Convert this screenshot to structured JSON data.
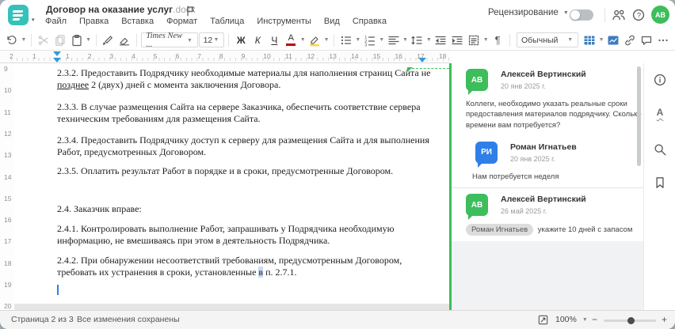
{
  "colors": {
    "teal": "#35c2ba",
    "green": "#3dbd5b",
    "blue": "#2e80e8",
    "toolbar_blue": "#3e7cc0",
    "marker_blue": "#2f9cdb",
    "font_color_red": "#c00000",
    "highlight_yellow": "#ffd43b"
  },
  "window": {
    "title": "Договор на оказание услуг",
    "ext": ".docx"
  },
  "menu": [
    "Файл",
    "Правка",
    "Вставка",
    "Формат",
    "Таблица",
    "Инструменты",
    "Вид",
    "Справка"
  ],
  "header": {
    "review": "Рецензирование",
    "avatar_initials": "АВ"
  },
  "toolbar": {
    "font": "Times New ...",
    "size": "12",
    "bold": "Ж",
    "italic": "К",
    "underline": "Ч",
    "color_letter": "А",
    "style": "Обычный"
  },
  "icons": {
    "pilcrow": "¶",
    "caret": "▾",
    "minus": "−",
    "plus": "+",
    "help": "?",
    "spell_letter": "А"
  },
  "ruler": {
    "h_pre": [
      "2",
      "1"
    ],
    "h": [
      "1",
      "2",
      "3",
      "4",
      "5",
      "6",
      "7",
      "8",
      "9",
      "10",
      "11",
      "12",
      "13",
      "14",
      "15",
      "16",
      "17",
      "18"
    ],
    "v": [
      "9",
      "10",
      "11",
      "12",
      "13",
      "14",
      "15",
      "16",
      "17",
      "18",
      "19",
      "20"
    ]
  },
  "document": {
    "paragraphs": [
      {
        "parts": [
          {
            "t": "2.3.2. Предоставить Подрядчику необходимые материалы для наполнения страниц Сайта не "
          },
          {
            "t": "позднее",
            "u": true
          },
          {
            "t": " 2 (двух) дней с момента заключения Договора."
          }
        ]
      },
      {
        "parts": [
          {
            "t": "2.3.3. В случае размещения Сайта на сервере Заказчика, обеспечить соответствие сервера техническим требованиям для размещения Сайта."
          }
        ]
      },
      {
        "parts": [
          {
            "t": "2.3.4. Предоставить Подрядчику доступ к серверу для размещения Сайта и для выполнения Работ, предусмотренных Договором."
          }
        ]
      },
      {
        "parts": [
          {
            "t": "2.3.5. Оплатить результат Работ в порядке и в сроки, предусмотренные Договором."
          }
        ]
      },
      {
        "parts": [
          {
            "t": "2.4. Заказчик вправе:"
          }
        ]
      },
      {
        "parts": [
          {
            "t": "2.4.1. Контролировать выполнение Работ, запрашивать у Подрядчика необходимую информацию, не вмешиваясь при этом в деятельность Подрядчика."
          }
        ]
      },
      {
        "parts": [
          {
            "t": "2.4.2. При обнаружении несоответствий требованиям, предусмотренным Договором, требовать их устранения в сроки, установленные "
          },
          {
            "t": "в",
            "hl": true
          },
          {
            "t": " п. 2.7.1."
          }
        ]
      }
    ]
  },
  "comments": [
    {
      "author": "Алексей Вертинский",
      "initials": "АВ",
      "color": "green",
      "date": "20 янв 2025 г.",
      "text": "Коллеги, необходимо указать реальные сроки предоставления материалов подрядчику. Сколько времени вам потребуется?",
      "reply": false,
      "divider_before": false,
      "mention": null
    },
    {
      "author": "Роман Игнатьев",
      "initials": "РИ",
      "color": "blue",
      "date": "20 янв 2025 г.",
      "text": "Нам потребуется неделя",
      "reply": true,
      "divider_before": false,
      "mention": null
    },
    {
      "author": "Алексей Вертинский",
      "initials": "АВ",
      "color": "green",
      "date": "26 май 2025 г.",
      "text": " укажите 10 дней с запасом",
      "reply": false,
      "divider_before": true,
      "mention": "Роман Игнатьев"
    }
  ],
  "status": {
    "page": "Страница 2 из 3",
    "saved": "Все изменения сохранены",
    "zoom": "100%"
  }
}
